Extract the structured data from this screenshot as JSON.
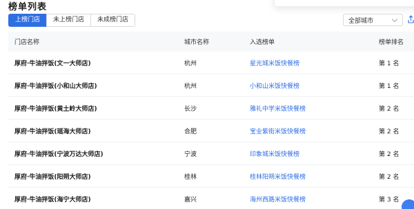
{
  "page": {
    "title": "榜单列表"
  },
  "tabs": [
    {
      "label": "上榜门店",
      "active": true
    },
    {
      "label": "未上榜门店",
      "active": false
    },
    {
      "label": "未成榜门店",
      "active": false
    }
  ],
  "filter": {
    "city_selected": "全部城市"
  },
  "table": {
    "headers": {
      "store": "门店名称",
      "city": "城市名称",
      "list": "入选榜单",
      "rank": "榜单排名"
    },
    "rows": [
      {
        "store": "厚府·牛油拌饭(文一大师店)",
        "city": "杭州",
        "list": "星光城米饭快餐榜",
        "rank": "第 1 名"
      },
      {
        "store": "厚府·牛油拌饭(小和山大师店)",
        "city": "杭州",
        "list": "小和山米饭快餐榜",
        "rank": "第 1 名"
      },
      {
        "store": "厚府·牛油拌饭(黄土岭大师店)",
        "city": "长沙",
        "list": "雅礼中学米饭快餐榜",
        "rank": "第 2 名"
      },
      {
        "store": "厚府·牛油拌饭(瑶海大师店)",
        "city": "合肥",
        "list": "宝业紫街米饭快餐榜",
        "rank": "第 2 名"
      },
      {
        "store": "厚府·牛油拌饭(宁波万达大师店)",
        "city": "宁波",
        "list": "印象城米饭快餐榜",
        "rank": "第 2 名"
      },
      {
        "store": "厚府·牛油拌饭(阳朔大师店)",
        "city": "桂林",
        "list": "桂林阳朔米饭快餐榜",
        "rank": "第 2 名"
      },
      {
        "store": "厚府·牛油拌饭(海宁大师店)",
        "city": "嘉兴",
        "list": "海州西路米饭快餐榜",
        "rank": "第 3 名"
      }
    ]
  },
  "colors": {
    "accent": "#2f6fe4",
    "header_bg": "#f7f8fa"
  }
}
